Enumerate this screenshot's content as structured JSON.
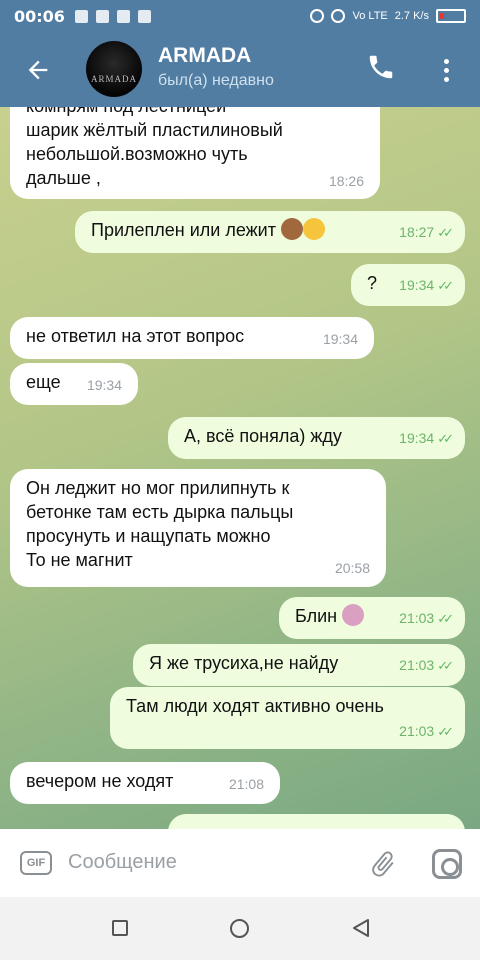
{
  "status_bar": {
    "time": "00:06",
    "network_label": "Vo LTE",
    "speed": "2.7 K/s"
  },
  "header": {
    "title": "ARMADA",
    "subtitle": "был(а) недавно",
    "avatar_text": "ARMADA"
  },
  "messages": [
    {
      "dir": "in",
      "text_lines": [
        "комнрям под лестницей",
        "шарик жёлтый пластилиновый",
        "небольшой.возможно чуть",
        "дальше ,"
      ],
      "time": "18:26"
    },
    {
      "dir": "out",
      "text": "Прилеплен или лежит",
      "emoji": [
        "see-no-evil-monkey",
        "laughing-face"
      ],
      "time": "18:27",
      "read": true
    },
    {
      "dir": "out",
      "text": "?",
      "time": "19:34",
      "read": true
    },
    {
      "dir": "in",
      "text": "не ответил на этот вопрос",
      "time": "19:34"
    },
    {
      "dir": "in",
      "text": "еще",
      "time": "19:34"
    },
    {
      "dir": "out",
      "text": "А, всё поняла) жду",
      "time": "19:34",
      "read": true
    },
    {
      "dir": "in",
      "text_lines": [
        "Он леджит но мог прилипнуть к",
        "бетонке там есть дырка пальцы",
        "просунуть и нащупать можно",
        "То не магнит"
      ],
      "time": "20:58"
    },
    {
      "dir": "out",
      "text": "Блин",
      "emoji": [
        "woman-facepalming"
      ],
      "time": "21:03",
      "read": true
    },
    {
      "dir": "out",
      "text": "Я же трусиха,не найду",
      "time": "21:03",
      "read": true
    },
    {
      "dir": "out",
      "text": "Там люди ходят активно очень",
      "time": "21:03",
      "read": true
    },
    {
      "dir": "in",
      "text": "вечером не ходят",
      "time": "21:08"
    }
  ],
  "composer": {
    "placeholder": "Сообщение",
    "gif_label": "GIF"
  },
  "colors": {
    "header_bg": "#517da2",
    "incoming_bubble": "#ffffff",
    "outgoing_bubble": "#effdde",
    "read_check": "#5fb962"
  }
}
